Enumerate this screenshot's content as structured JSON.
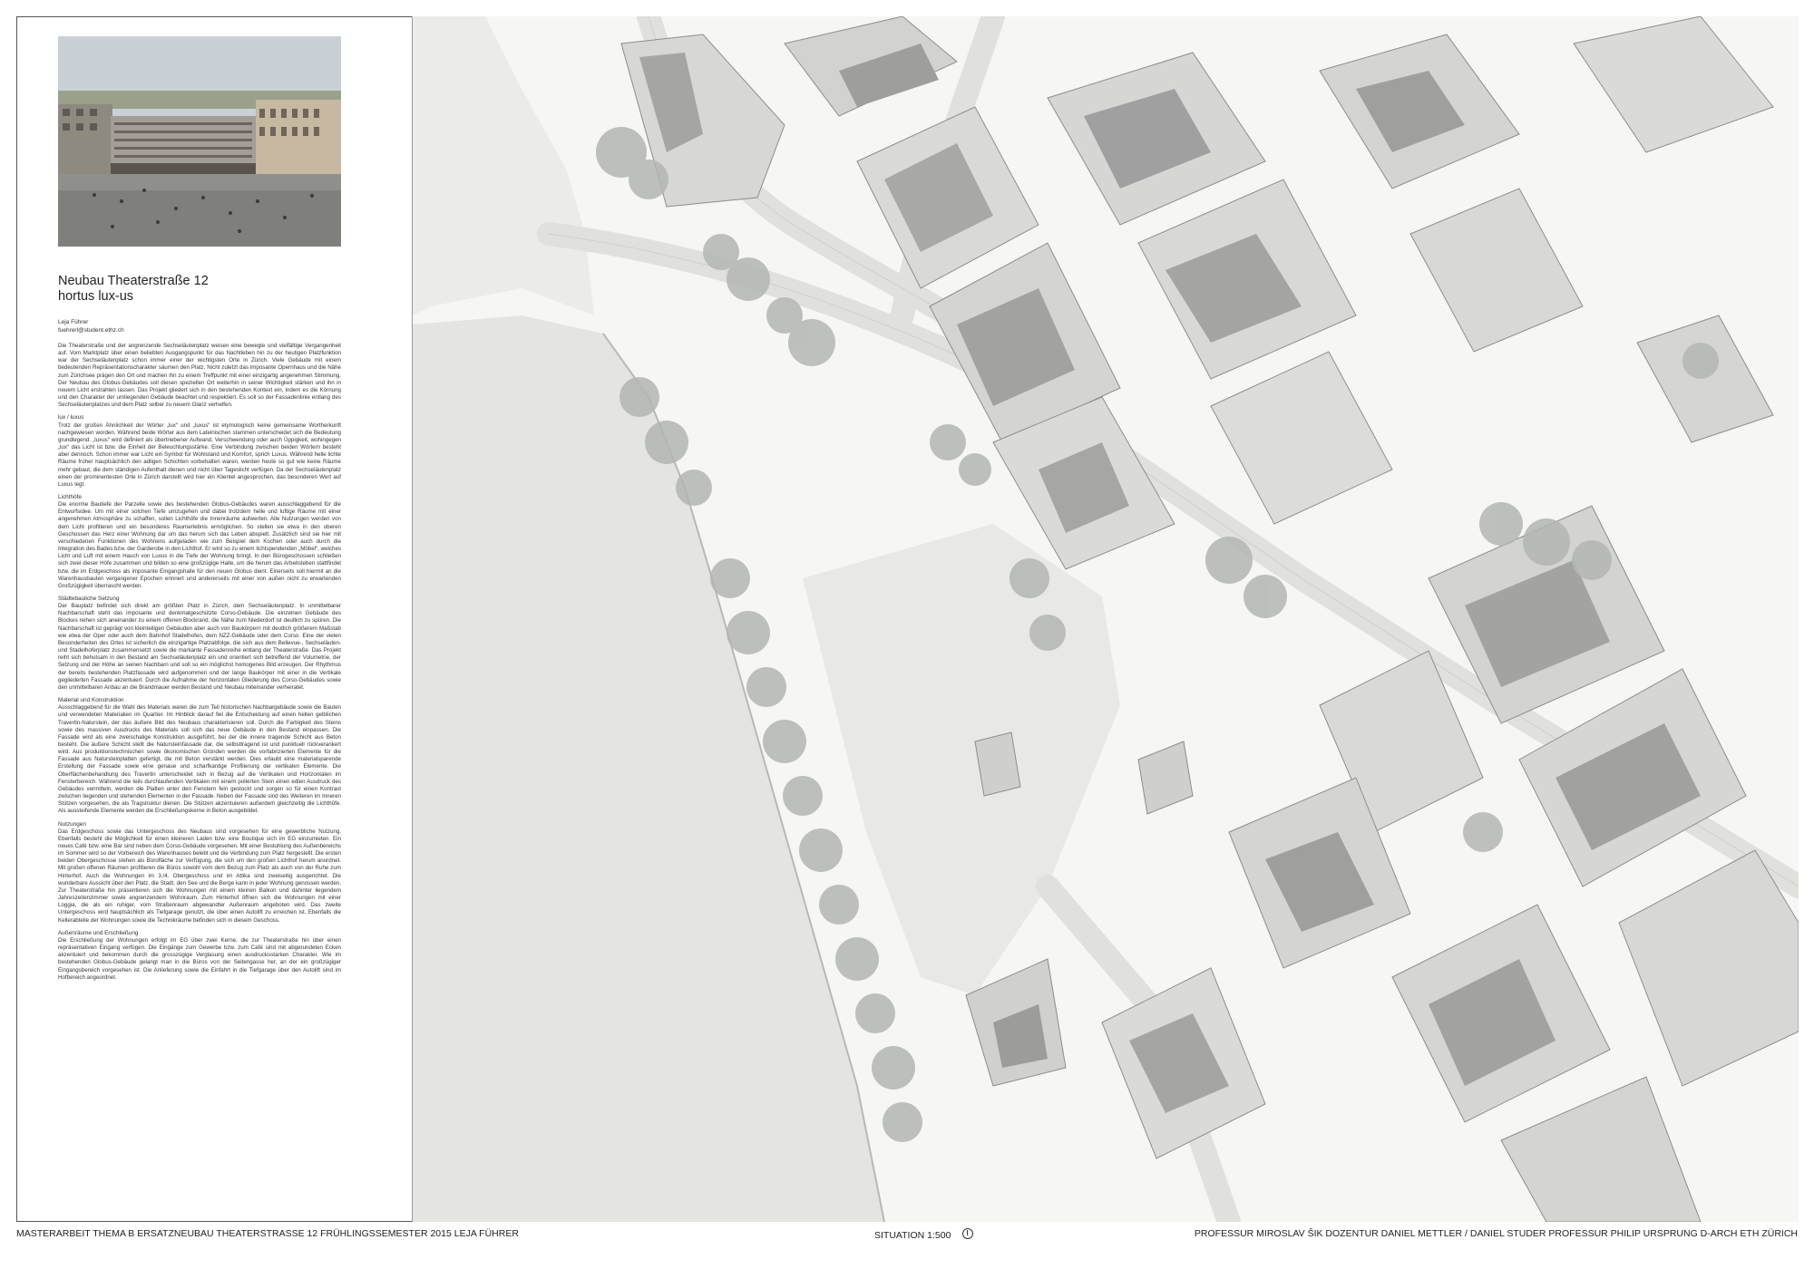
{
  "project": {
    "title_line1": "Neubau Theaterstraße 12",
    "title_line2": "hortus lux-us",
    "author_name": "Leja Führer",
    "author_email": "fuehrerl@student.ethz.ch"
  },
  "text_sections": [
    {
      "heading": "",
      "text": "Die Theaterstraße und der angrenzende Sechseläutenplatz weisen eine bewegte und vielfältige Vergangenheit auf. Vom Marktplatz über einen beliebten Ausgangspunkt für das Nachtleben hin zu der heutigen Platzfunktion war der Sechseläutenplatz schon immer einer der wichtigsten Orte in Zürich. Viele Gebäude mit einem bedeutenden Repräsentationscharakter säumen den Platz. Nicht zuletzt das imposante Opernhaus und die Nähe zum Zürichsee prägen den Ort und machen ihn zu einem Treffpunkt mit einer einzigartig angenehmen Stimmung. Der Neubau des Globus-Gebäudes soll diesen speziellen Ort weiterhin in seiner Wichtigkeit stärken und ihn in neuem Licht erstrahlen lassen. Das Projekt gliedert sich in den bestehenden Kontext ein, indem es die Körnung und den Charakter der umliegenden Gebäude beachtet und respektiert. Es soll so der Fassadenlinie entlang des Sechseläutenplatzes und dem Platz selber zu neuem Glanz verhelfen."
    },
    {
      "heading": "lux / luxus",
      "text": "Trotz der großen Ähnlichkeit der Wörter „lux“ und „luxus“ ist etymologisch keine gemeinsame Wortherkunft nachgewiesen worden. Während beide Wörter aus dem Lateinischen stammen unterscheidet sich die Bedeutung grundlegend. „luxus“ wird definiert als übertriebener Aufwand, Verschwendung oder auch Üppigkeit, wohingegen „lux“ das Licht ist bzw. die Einheit der Beleuchtungsstärke. Eine Verbindung zwischen beiden Wörtern besteht aber dennoch. Schon immer war Licht ein Symbol für Wohlstand und Komfort, sprich Luxus. Während helle lichte Räume früher hauptsächlich den adligen Schichten vorbehalten waren, werden heute so gut wie keine Räume mehr gebaut, die dem ständigen Aufenthalt dienen und nicht über Tageslicht verfügen. Da der Sechseläutenplatz einen der prominentesten Orte in Zürich darstellt wird hier ein Klientel angesprochen, das besonderen Wert auf Luxus legt."
    },
    {
      "heading": "Lichthöfe",
      "text": "Die enorme Bautiefe der Parzelle sowie des bestehenden Globus-Gebäudes waren ausschlaggebend für die Entwurfsidee. Um mit einer solchen Tiefe umzugehen und dabei trotzdem helle und luftige Räume mit einer angenehmen Atmosphäre zu schaffen, sollen Lichthöfe die Innenräume aufwerten. Alle Nutzungen werden von dem Licht profitieren und ein besonderes Raumerlebnis ermöglichen. So stellen sie etwa in den oberen Geschossen das Herz einer Wohnung dar um das herum sich das Leben abspielt. Zusätzlich sind sie hier mit verschiedenen Funktionen des Wohnens aufgeladen wie zum Beispiel dem Kochen oder auch durch die Integration des Bades bzw. der Garderobe in den Lichthof. Er wird so zu einem lichtspendenden „Möbel“, welches Licht und Luft mit einem Hauch von Luxus in die Tiefe der Wohnung bringt. In den Bürogeschossen schließen sich zwei dieser Höfe zusammen und bilden so eine großzügige Halle, um die herum das Arbeitsleben stattfindet bzw. die im Erdgeschoss als imposante Eingangshalle für den neuen Globus dient. Einerseits soll hiermit an die Warenhausbauten vergangener Epochen erinnert und andererseits mit einer von außen nicht zu erwartenden Großzügigkeit überrascht werden."
    },
    {
      "heading": "Städtebauliche Setzung",
      "text": "Der Bauplatz befindet sich direkt am größten Platz in Zürich, dem Sechseläutenplatz. In unmittelbarer Nachbarschaft steht das imposante und denkmalgeschützte Corso-Gebäude. Die einzelnen Gebäude des Blockes reihen sich aneinander zu einem offenen Blockrand, die Nähe zum Niederdorf ist deutlich zu spüren. Die Nachbarschaft ist geprägt von kleinteiligen Gebäuden aber auch von Baukörpern mit deutlich größerem Maßstab wie etwa der Oper oder auch dem Bahnhof Stadelhofen, dem NZZ-Gebäude oder dem Corso. Eine der vielen Besonderheiten des Ortes ist sicherlich die einzigartige Platzabfolge, die sich aus dem Bellevue-, Sechseläuten- und Stadelhoferplatz zusammensetzt sowie die markante Fassadenreihe entlang der Theaterstraße. Das Projekt reiht sich behutsam in den Bestand am Sechseläutenplatz ein und orientiert sich betreffend der Volumetrie, der Setzung und der Höhe an seinen Nachbarn und soll so ein möglichst homogenes Bild erzeugen. Der Rhythmus der bereits bestehenden Platzfassade wird aufgenommen und der lange Baukörper mit einer in die Vertikale gegliederten Fassade akzentuiert. Durch die Aufnahme der horizontalen Gliederung des Corso-Gebäudes sowie den unmittelbaren Anbau an die Brandmauer werden Bestand und Neubau miteinander verheiratet."
    },
    {
      "heading": "Material und Konstruktion",
      "text": "Ausschlaggebend für die Wahl des Materials waren die zum Teil historischen Nachbargebäude sowie die Bauten und verwendeten Materialien im Quartier. Im Hinblick darauf fiel die Entscheidung auf einen hellen gelblichen Travertin-Naturstein, der das äußere Bild des Neubaus charakterisieren soll. Durch die Farbigkeit des Steins sowie des massiven Ausdrucks des Materials soll sich das neue Gebäude in den Bestand einpassen. Die Fassade wird als eine zweischalige Konstruktion ausgeführt, bei der die innere tragende Schicht aus Beton besteht. Die äußere Schicht stellt die Natursteinfassade dar, die selbsttragend ist und punktuell rückverankert wird. Aus produktionstechnischen sowie ökonomischen Gründen werden die vorfabrizierten Elemente für die Fassade aus Natursteinplatten gefertigt, die mit Beton verstärkt werden. Dies erlaubt eine materialsparende Erstellung der Fassade sowie eine genaue und scharfkantige Profilierung der vertikalen Elemente. Die Oberflächenbehandlung des Travertin unterscheidet sich in Bezug auf die Vertikalen und Horizontalen im Fensterbereich. Während die teils durchlaufenden Vertikalen mit einem polierten Stein einen edlen Ausdruck des Gebäudes vermitteln, werden die Platten unter den Fenstern fein gestockt und sorgen so für einen Kontrast zwischen liegenden und stehenden Elementen in der Fassade. Neben der Fassade sind des Weiteren im Inneren Stützen vorgesehen, die als Tragstruktur dienen. Die Stützen akzentuieren außerdem gleichzeitig die Lichthöfe. Als aussteifende Elemente werden die Erschließungskerne in Beton ausgebildet."
    },
    {
      "heading": "Nutzungen",
      "text": "Das Erdgeschoss sowie das Untergeschoss des Neubaus sind vorgesehen für eine gewerbliche Nutzung. Ebenfalls besteht die Möglichkeit für einen kleineren Laden bzw. eine Boutique sich im EG einzumieten. Ein neues Café bzw. eine Bar sind neben dem Corso-Gebäude vorgesehen. Mit einer Bestuhlung des Außenbereichs im Sommer wird so der Vorbereich des Warenhauses belebt und die Verbindung zum Platz hergestellt. Die ersten beiden Obergeschosse stehen als Bürofläche zur Verfügung, die sich um den großen Lichthof herum anordnet. Mit großen offenen Räumen profitieren die Büros sowohl vom dem Bezug zum Platz als auch von der Ruhe zum Hinterhof. Auch die Wohnungen im 3./4. Obergeschoss und im Attika sind zweiseitig ausgerichtet. Die wunderbare Aussicht über den Platz, die Stadt, den See und die Berge kann in jeder Wohnung genossen werden. Zur Theaterstraße hin präsentieren sich die Wohnungen mit einem kleinen Balkon und dahinter liegendem Jahreszeitenzimmer sowie angrenzendem Wohnraum. Zum Hinterhof öffnen sich die Wohnungen mit einer Loggia, die als ein ruhiger, vom Straßenraum abgewandter Außenraum angeboten wird. Das zweite Untergeschoss wird hauptsächlich als Tiefgarage genutzt, die über einen Autolift zu erreichen ist. Ebenfalls die Kellerabteile der Wohnungen sowie die Technikräume befinden sich in diesem Geschoss."
    },
    {
      "heading": "Außenräume und Erschließung",
      "text": "Die Erschließung der Wohnungen erfolgt im EG über zwei Kerne, die zur Theaterstraße hin über einen repräsentativen Eingang verfügen. Die Eingänge zum Gewerbe bzw. zum Café sind mit abgerundeten Ecken akzentuiert und bekommen durch die grosszügige Verglasung einen ausdrucksstarken Charakter. Wie im bestehenden Globus-Gebäude gelangt man in die Büros von der Seitengasse her, an der ein großzügiger Eingangsbereich vorgesehen ist. Die Anlieferung sowie die Einfahrt in die Tiefgarage über den Autolift sind im Hofbereich angeordnet."
    }
  ],
  "footer": {
    "left": "MASTERARBEIT THEMA B ERSATZNEUBAU THEATERSTRASSE 12    FRÜHLINGSSEMESTER 2015    LEJA FÜHRER",
    "center": "SITUATION 1:500",
    "right": "PROFESSUR MIROSLAV ŠIK    DOZENTUR DANIEL METTLER / DANIEL STUDER    PROFESSUR PHILIP URSPRUNG    D-ARCH    ETH ZÜRICH"
  },
  "colors": {
    "paper": "#ffffff",
    "lake": "#e6e7e5",
    "street": "#f1f1ef",
    "plaza": "#e9e9e6",
    "roof_light": "#d6d6d4",
    "roof_dark": "#9f9f9d",
    "tree": "#aeb1ae"
  },
  "icons": {
    "north_arrow": "north-arrow-icon"
  }
}
